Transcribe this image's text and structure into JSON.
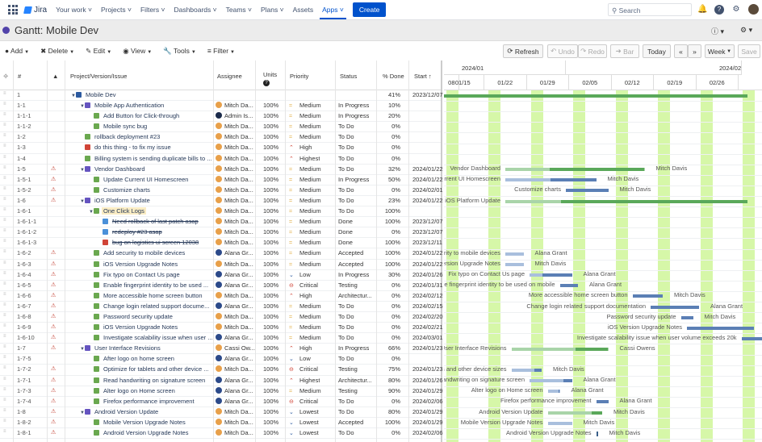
{
  "topnav": {
    "product": "Jira",
    "items": [
      "Your work",
      "Projects",
      "Filters",
      "Dashboards",
      "Teams",
      "Plans",
      "Assets",
      "Apps"
    ],
    "dropdown_items": [
      true,
      true,
      true,
      true,
      true,
      true,
      false,
      true
    ],
    "active": "Apps",
    "create": "Create",
    "search_placeholder": "Search"
  },
  "title": "Gantt:  Mobile Dev",
  "toolbar": {
    "add": "Add",
    "delete": "Delete",
    "edit": "Edit",
    "view": "View",
    "tools": "Tools",
    "filter": "Filter",
    "refresh": "Refresh",
    "undo": "Undo",
    "redo": "Redo",
    "bar": "Bar",
    "today": "Today",
    "prev": "«",
    "next": "»",
    "scale": "Week",
    "save": "Save"
  },
  "columns": {
    "num": "#",
    "name": "Project/Version/Issue",
    "assignee": "Assignee",
    "units": "Units",
    "priority": "Priority",
    "status": "Status",
    "done": "% Done",
    "start": "Start"
  },
  "colors": {
    "accent": "#0052cc",
    "weekend": "#d6f7a8",
    "summary_bar": "#5aa85a",
    "task_bar": "#5b7fb5",
    "story": "#6aa84f",
    "bug": "#d04437",
    "epic": "#6554c0"
  },
  "timeline": {
    "months": [
      "2024/01",
      "2024/02"
    ],
    "weeks": [
      "08",
      "01/15",
      "01/22",
      "01/29",
      "02/05",
      "02/12",
      "02/19",
      "02/26"
    ]
  },
  "rows": [
    {
      "id": "1",
      "warn": false,
      "lvl": 0,
      "tw": true,
      "type": "project",
      "name": "Mobile Dev",
      "asg": "",
      "av": "",
      "units": "",
      "pri": "",
      "stat": "",
      "done": "41%",
      "start": "2023/12/07"
    },
    {
      "id": "1-1",
      "warn": false,
      "lvl": 1,
      "tw": true,
      "type": "epic",
      "name": "Mobile App Authentication",
      "asg": "Mitch Da...",
      "av": "md",
      "units": "100%",
      "pri": "Medium",
      "stat": "In Progress",
      "done": "10%",
      "start": ""
    },
    {
      "id": "1-1-1",
      "warn": false,
      "lvl": 2,
      "tw": false,
      "type": "story",
      "name": "Add Button for Click-through",
      "asg": "Admin Is...",
      "av": "ai",
      "units": "100%",
      "pri": "Medium",
      "stat": "In Progress",
      "done": "20%",
      "start": ""
    },
    {
      "id": "1-1-2",
      "warn": false,
      "lvl": 2,
      "tw": false,
      "type": "story",
      "name": "Mobile sync bug",
      "asg": "Mitch Da...",
      "av": "md",
      "units": "100%",
      "pri": "Medium",
      "stat": "To Do",
      "done": "0%",
      "start": ""
    },
    {
      "id": "1-2",
      "warn": false,
      "lvl": 1,
      "tw": false,
      "type": "story",
      "name": "rollback deployment #23",
      "asg": "Mitch Da...",
      "av": "md",
      "units": "100%",
      "pri": "Medium",
      "stat": "To Do",
      "done": "0%",
      "start": ""
    },
    {
      "id": "1-3",
      "warn": false,
      "lvl": 1,
      "tw": false,
      "type": "bug",
      "name": "do this thing - to fix my issue",
      "asg": "Mitch Da...",
      "av": "md",
      "units": "100%",
      "pri": "High",
      "stat": "To Do",
      "done": "0%",
      "start": ""
    },
    {
      "id": "1-4",
      "warn": false,
      "lvl": 1,
      "tw": false,
      "type": "story",
      "name": "Billing system is sending duplicate bills to ...",
      "asg": "Mitch Da...",
      "av": "md",
      "units": "100%",
      "pri": "Highest",
      "stat": "To Do",
      "done": "0%",
      "start": ""
    },
    {
      "id": "1-5",
      "warn": true,
      "lvl": 1,
      "tw": true,
      "type": "epic",
      "name": "Vendor Dashboard",
      "asg": "Mitch Da...",
      "av": "md",
      "units": "100%",
      "pri": "Medium",
      "stat": "To Do",
      "done": "32%",
      "start": "2024/01/22"
    },
    {
      "id": "1-5-1",
      "warn": true,
      "lvl": 2,
      "tw": false,
      "type": "story",
      "name": "Update Current UI Homescreen",
      "asg": "Mitch Da...",
      "av": "md",
      "units": "100%",
      "pri": "Medium",
      "stat": "In Progress",
      "done": "50%",
      "start": "2024/01/22"
    },
    {
      "id": "1-5-2",
      "warn": true,
      "lvl": 2,
      "tw": false,
      "type": "story",
      "name": "Customize charts",
      "asg": "Mitch Da...",
      "av": "md",
      "units": "100%",
      "pri": "Medium",
      "stat": "To Do",
      "done": "0%",
      "start": "2024/02/01"
    },
    {
      "id": "1-6",
      "warn": true,
      "lvl": 1,
      "tw": true,
      "type": "epic",
      "name": "iOS Platform Update",
      "asg": "Mitch Da...",
      "av": "md",
      "units": "100%",
      "pri": "Medium",
      "stat": "To Do",
      "done": "23%",
      "start": "2024/01/22"
    },
    {
      "id": "1-6-1",
      "warn": false,
      "lvl": 2,
      "tw": true,
      "type": "story",
      "name": "One Click Logs",
      "asg": "Mitch Da...",
      "av": "md",
      "units": "100%",
      "pri": "Medium",
      "stat": "To Do",
      "done": "100%",
      "start": "",
      "sel": true
    },
    {
      "id": "1-6-1-1",
      "warn": false,
      "lvl": 3,
      "tw": false,
      "type": "task",
      "name": "Need rollback of last patch asap",
      "asg": "Mitch Da...",
      "av": "md",
      "units": "100%",
      "pri": "Medium",
      "stat": "Done",
      "done": "100%",
      "start": "2023/12/07",
      "strike": true
    },
    {
      "id": "1-6-1-2",
      "warn": false,
      "lvl": 3,
      "tw": false,
      "type": "task",
      "name": "redeploy #23 asap",
      "asg": "Mitch Da...",
      "av": "md",
      "units": "100%",
      "pri": "Medium",
      "stat": "Done",
      "done": "0%",
      "start": "2023/12/07",
      "strike": true
    },
    {
      "id": "1-6-1-3",
      "warn": false,
      "lvl": 3,
      "tw": false,
      "type": "bug",
      "name": "bug on logistics ui screen 12038",
      "asg": "Mitch Da...",
      "av": "md",
      "units": "100%",
      "pri": "Medium",
      "stat": "Done",
      "done": "100%",
      "start": "2023/12/11",
      "strike": true
    },
    {
      "id": "1-6-2",
      "warn": true,
      "lvl": 2,
      "tw": false,
      "type": "story",
      "name": "Add security to mobile devices",
      "asg": "Alana Gr...",
      "av": "ag",
      "units": "100%",
      "pri": "Medium",
      "stat": "Accepted",
      "done": "100%",
      "start": "2024/01/22"
    },
    {
      "id": "1-6-3",
      "warn": true,
      "lvl": 2,
      "tw": false,
      "type": "story",
      "name": "iOS Version Upgrade Notes",
      "asg": "Mitch Da...",
      "av": "md",
      "units": "100%",
      "pri": "Medium",
      "stat": "Accepted",
      "done": "100%",
      "start": "2024/01/22"
    },
    {
      "id": "1-6-4",
      "warn": true,
      "lvl": 2,
      "tw": false,
      "type": "story",
      "name": "Fix typo on Contact Us page",
      "asg": "Alana Gr...",
      "av": "ag",
      "units": "100%",
      "pri": "Low",
      "stat": "In Progress",
      "done": "30%",
      "start": "2024/01/26"
    },
    {
      "id": "1-6-5",
      "warn": true,
      "lvl": 2,
      "tw": false,
      "type": "story",
      "name": "Enable fingerprint identity to be used ...",
      "asg": "Alana Gr...",
      "av": "ag",
      "units": "100%",
      "pri": "Critical",
      "stat": "Testing",
      "done": "0%",
      "start": "2024/01/31"
    },
    {
      "id": "1-6-6",
      "warn": true,
      "lvl": 2,
      "tw": false,
      "type": "story",
      "name": "More accessible home screen button",
      "asg": "Mitch Da...",
      "av": "md",
      "units": "100%",
      "pri": "High",
      "stat": "Architectur...",
      "done": "0%",
      "start": "2024/02/12"
    },
    {
      "id": "1-6-7",
      "warn": true,
      "lvl": 2,
      "tw": false,
      "type": "story",
      "name": "Change login related support docume...",
      "asg": "Alana Gr...",
      "av": "ag",
      "units": "100%",
      "pri": "Medium",
      "stat": "To Do",
      "done": "0%",
      "start": "2024/02/15"
    },
    {
      "id": "1-6-8",
      "warn": true,
      "lvl": 2,
      "tw": false,
      "type": "story",
      "name": "Password security update",
      "asg": "Mitch Da...",
      "av": "md",
      "units": "100%",
      "pri": "Medium",
      "stat": "To Do",
      "done": "0%",
      "start": "2024/02/20"
    },
    {
      "id": "1-6-9",
      "warn": true,
      "lvl": 2,
      "tw": false,
      "type": "story",
      "name": "iOS Version Upgrade Notes",
      "asg": "Mitch Da...",
      "av": "md",
      "units": "100%",
      "pri": "Medium",
      "stat": "To Do",
      "done": "0%",
      "start": "2024/02/21"
    },
    {
      "id": "1-6-10",
      "warn": true,
      "lvl": 2,
      "tw": false,
      "type": "story",
      "name": "Investigate scalability issue when user ...",
      "asg": "Alana Gr...",
      "av": "ag",
      "units": "100%",
      "pri": "Medium",
      "stat": "To Do",
      "done": "0%",
      "start": "2024/03/01"
    },
    {
      "id": "1-7",
      "warn": true,
      "lvl": 1,
      "tw": true,
      "type": "epic",
      "name": "User Interface Revisions",
      "asg": "Cassi Ow...",
      "av": "co",
      "units": "100%",
      "pri": "High",
      "stat": "In Progress",
      "done": "66%",
      "start": "2024/01/23"
    },
    {
      "id": "1-7-5",
      "warn": false,
      "lvl": 2,
      "tw": false,
      "type": "story",
      "name": "After logo on home screen",
      "asg": "Alana Gr...",
      "av": "ag",
      "units": "100%",
      "pri": "Low",
      "stat": "To Do",
      "done": "0%",
      "start": ""
    },
    {
      "id": "1-7-2",
      "warn": true,
      "lvl": 2,
      "tw": false,
      "type": "story",
      "name": "Optimize for tablets and other device ...",
      "asg": "Mitch Da...",
      "av": "md",
      "units": "100%",
      "pri": "Critical",
      "stat": "Testing",
      "done": "75%",
      "start": "2024/01/23"
    },
    {
      "id": "1-7-1",
      "warn": true,
      "lvl": 2,
      "tw": false,
      "type": "story",
      "name": "Read handwriting on signature screen",
      "asg": "Alana Gr...",
      "av": "ag",
      "units": "100%",
      "pri": "Highest",
      "stat": "Architectur...",
      "done": "80%",
      "start": "2024/01/26"
    },
    {
      "id": "1-7-3",
      "warn": true,
      "lvl": 2,
      "tw": false,
      "type": "story",
      "name": "Alter logo on Home screen",
      "asg": "Alana Gr...",
      "av": "ag",
      "units": "100%",
      "pri": "Medium",
      "stat": "Testing",
      "done": "90%",
      "start": "2024/01/29"
    },
    {
      "id": "1-7-4",
      "warn": true,
      "lvl": 2,
      "tw": false,
      "type": "story",
      "name": "Firefox performance improvement",
      "asg": "Alana Gr...",
      "av": "ag",
      "units": "100%",
      "pri": "Critical",
      "stat": "To Do",
      "done": "0%",
      "start": "2024/02/06"
    },
    {
      "id": "1-8",
      "warn": true,
      "lvl": 1,
      "tw": true,
      "type": "epic",
      "name": "Android Version Update",
      "asg": "Mitch Da...",
      "av": "md",
      "units": "100%",
      "pri": "Lowest",
      "stat": "To Do",
      "done": "80%",
      "start": "2024/01/29"
    },
    {
      "id": "1-8-2",
      "warn": true,
      "lvl": 2,
      "tw": false,
      "type": "story",
      "name": "Mobile Version Upgrade Notes",
      "asg": "Mitch Da...",
      "av": "md",
      "units": "100%",
      "pri": "Lowest",
      "stat": "Accepted",
      "done": "100%",
      "start": "2024/01/29"
    },
    {
      "id": "1-8-1",
      "warn": true,
      "lvl": 2,
      "tw": false,
      "type": "story",
      "name": "Android Version Upgrade Notes",
      "asg": "Mitch Da...",
      "av": "md",
      "units": "100%",
      "pri": "Lowest",
      "stat": "To Do",
      "done": "0%",
      "start": "2024/02/06"
    }
  ],
  "gantt_bars": [
    {
      "row": 0,
      "kind": "summary",
      "start": "2024/01/09",
      "end": "2024/03/02",
      "progress": 0.02,
      "label_left": "",
      "label_right": ""
    },
    {
      "row": 7,
      "kind": "summary",
      "start": "2024/01/22",
      "end": "2024/02/14",
      "progress": 0.32,
      "label_left": "Vendor Dashboard",
      "label_right": "Mitch Davis"
    },
    {
      "row": 8,
      "kind": "task",
      "start": "2024/01/22",
      "end": "2024/02/06",
      "progress": 0.5,
      "label_left": "Update Current UI Homescreen",
      "label_right": "Mitch Davis"
    },
    {
      "row": 9,
      "kind": "task",
      "start": "2024/02/01",
      "end": "2024/02/08",
      "progress": 0,
      "label_left": "Customize charts",
      "label_right": "Mitch Davis"
    },
    {
      "row": 10,
      "kind": "summary",
      "start": "2024/01/22",
      "end": "2024/03/02",
      "progress": 0.23,
      "label_left": "iOS Platform Update",
      "label_right": ""
    },
    {
      "row": 15,
      "kind": "task",
      "start": "2024/01/22",
      "end": "2024/01/25",
      "progress": 1,
      "label_left": "Add security to mobile devices",
      "label_right": "Alana Grant"
    },
    {
      "row": 16,
      "kind": "task",
      "start": "2024/01/22",
      "end": "2024/01/25",
      "progress": 1,
      "label_left": "iOS Version Upgrade Notes",
      "label_right": "Mitch Davis"
    },
    {
      "row": 17,
      "kind": "task",
      "start": "2024/01/26",
      "end": "2024/02/02",
      "progress": 0.3,
      "label_left": "Fix typo on Contact Us page",
      "label_right": "Alana Grant"
    },
    {
      "row": 18,
      "kind": "task",
      "start": "2024/01/31",
      "end": "2024/02/03",
      "progress": 0,
      "label_left": "Enable fingerprint identity to be used on mobile",
      "label_right": "Alana Grant"
    },
    {
      "row": 19,
      "kind": "task",
      "start": "2024/02/12",
      "end": "2024/02/17",
      "progress": 0,
      "label_left": "More accessible home screen button",
      "label_right": "Mitch Davis"
    },
    {
      "row": 20,
      "kind": "task",
      "start": "2024/02/15",
      "end": "2024/02/23",
      "progress": 0,
      "label_left": "Change login related support documentation",
      "label_right": "Alana Grant"
    },
    {
      "row": 21,
      "kind": "task",
      "start": "2024/02/20",
      "end": "2024/02/22",
      "progress": 0,
      "label_left": "Password security update",
      "label_right": "Mitch Davis"
    },
    {
      "row": 22,
      "kind": "task",
      "start": "2024/02/21",
      "end": "2024/03/03",
      "progress": 0,
      "label_left": "iOS Version Upgrade Notes",
      "label_right": "Mitch Davis"
    },
    {
      "row": 23,
      "kind": "task",
      "start": "2024/03/01",
      "end": "2024/03/05",
      "progress": 0,
      "label_left": "Investigate scalability issue when user volume exceeds 20k",
      "label_right": ""
    },
    {
      "row": 24,
      "kind": "summary",
      "start": "2024/01/23",
      "end": "2024/02/08",
      "progress": 0.66,
      "label_left": "User Interface Revisions",
      "label_right": "Cassi Owens"
    },
    {
      "row": 26,
      "kind": "task",
      "start": "2024/01/23",
      "end": "2024/01/28",
      "progress": 0.75,
      "label_left": "Optimize for tablets and other device sizes",
      "label_right": "Mitch Davis"
    },
    {
      "row": 27,
      "kind": "task",
      "start": "2024/01/26",
      "end": "2024/02/02",
      "progress": 0.8,
      "label_left": "Read handwriting on signature screen",
      "label_right": "Alana Grant"
    },
    {
      "row": 28,
      "kind": "task",
      "start": "2024/01/29",
      "end": "2024/01/31",
      "progress": 0.9,
      "label_left": "Alter logo on Home screen",
      "label_right": "Alana Grant"
    },
    {
      "row": 29,
      "kind": "task",
      "start": "2024/02/06",
      "end": "2024/02/08",
      "progress": 0,
      "label_left": "Firefox performance improvement",
      "label_right": "Alana Grant"
    },
    {
      "row": 30,
      "kind": "summary",
      "start": "2024/01/29",
      "end": "2024/02/07",
      "progress": 0.8,
      "label_left": "Android Version Update",
      "label_right": "Mitch Davis"
    },
    {
      "row": 31,
      "kind": "task",
      "start": "2024/01/29",
      "end": "2024/02/02",
      "progress": 1,
      "label_left": "Mobile Version Upgrade Notes",
      "label_right": "Mitch Davis"
    },
    {
      "row": 32,
      "kind": "milestone",
      "start": "2024/02/06",
      "end": "2024/02/06",
      "progress": 0,
      "label_left": "Android Version Upgrade Notes",
      "label_right": "Mitch Davis"
    }
  ]
}
